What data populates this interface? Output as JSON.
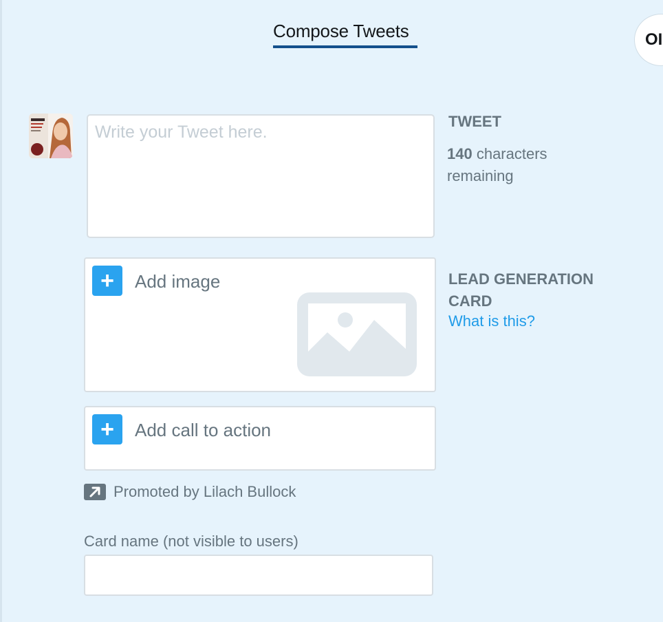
{
  "header": {
    "title": "Compose Tweets",
    "corner_label": "OI"
  },
  "tweet": {
    "placeholder": "Write your Tweet here.",
    "label": "TWEET",
    "char_count": "140",
    "char_suffix": " characters remaining"
  },
  "card": {
    "add_image_label": "Add image",
    "add_cta_label": "Add call to action",
    "type_label": "LEAD GENERATION CARD",
    "help_link": "What is this?",
    "promoted_by": "Promoted by Lilach Bullock",
    "name_label": "Card name (not visible to users)",
    "name_value": ""
  },
  "icons": {
    "plus": "plus-icon",
    "image_placeholder": "image-placeholder-icon",
    "promoted": "promoted-arrow-icon",
    "avatar": "avatar"
  },
  "colors": {
    "background": "#e6f3fc",
    "accent": "#2aa3ef",
    "link": "#1f9be8",
    "tab_underline": "#14508c",
    "text": "#66757f"
  }
}
